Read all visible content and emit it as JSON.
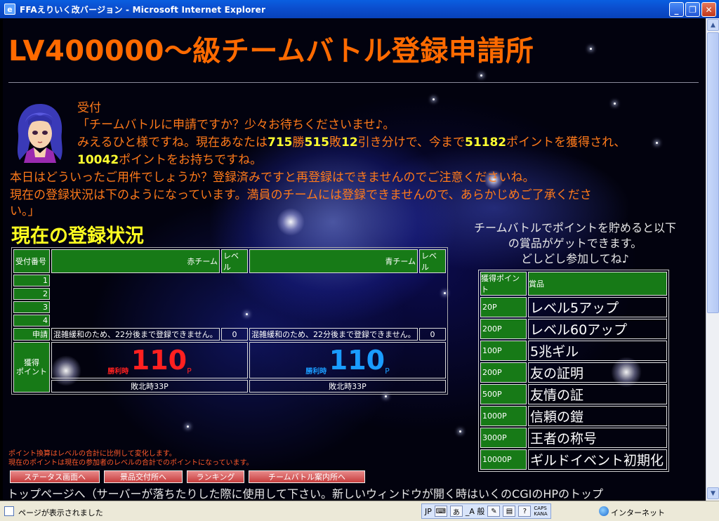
{
  "window": {
    "title": "FFAえりいく改バージョン - Microsoft Internet Explorer",
    "min_label": "_",
    "max_label": "❐",
    "close_label": "✕"
  },
  "page": {
    "title": "LV400000～級チームバトル登録申請所",
    "reception": {
      "speaker": "受付",
      "line1": "「チームバトルに申請ですか？少々お待ちくださいませ♪。",
      "line2_a": "みえるひと様ですね。現在あなたは",
      "wins": "715",
      "wins_unit": "勝",
      "losses": "515",
      "losses_unit": "敗",
      "draws": "12",
      "line2_b": "引き分けで、今まで",
      "points": "51182",
      "line2_c": "ポイントを獲得され、",
      "held_points": "10042",
      "line3": "ポイントをお持ちですね。",
      "line4": "本日はどういったご用件でしょうか？登録済みですと再登録はできませんのでご注意くださいね。",
      "line5": "現在の登録状況は下のようになっています。満員のチームには登録できませんので、あらかじめご了承くださ",
      "line6": "い。」"
    },
    "status_title": "現在の登録状況",
    "table": {
      "headers": {
        "number": "受付番号",
        "red_team": "赤チーム",
        "red_level": "レベル",
        "blue_team": "青チーム",
        "blue_level": "レベル"
      },
      "rows": [
        "1",
        "2",
        "3",
        "4"
      ],
      "apply_label": "申請",
      "red_note": "混雑緩和のため、22分後まで登録できません。",
      "red_level_value": "0",
      "blue_note": "混雑緩和のため、22分後まで登録できません。",
      "blue_level_value": "0",
      "points_label_1": "獲得",
      "points_label_2": "ポイント",
      "win_label": "勝利時",
      "red_win_points": "110",
      "blue_win_points": "110",
      "points_unit": "P",
      "red_lose": "敗北時33P",
      "blue_lose": "敗北時33P"
    },
    "prize_intro": [
      "チームバトルでポイントを貯めると以下",
      "の賞品がゲットできます。",
      "どしどし参加してね♪"
    ],
    "prize_table": {
      "header_points": "獲得ポイント",
      "header_item": "賞品",
      "rows": [
        {
          "points": "20P",
          "item": "レベル5アップ"
        },
        {
          "points": "200P",
          "item": "レベル60アップ"
        },
        {
          "points": "100P",
          "item": "5兆ギル"
        },
        {
          "points": "200P",
          "item": "友の証明"
        },
        {
          "points": "500P",
          "item": "友情の証"
        },
        {
          "points": "1000P",
          "item": "信頼の鎧"
        },
        {
          "points": "3000P",
          "item": "王者の称号"
        },
        {
          "points": "10000P",
          "item": "ギルドイベント初期化"
        }
      ]
    },
    "notes": [
      "ポイント換算はレベルの合計に比例して変化します。",
      "現在のポイントは現在の参加者のレベルの合計でのポイントになっています。"
    ],
    "buttons": {
      "status": "ステータス画面へ",
      "prize": "景品交付所へ",
      "ranking": "ランキング",
      "guide": "チームバトル案内所へ"
    },
    "bottom_text": "トップページへ（サーバーが落ちたりした際に使用して下さい。新しいウィンドウが開く時はいくのCGIのHPのトップ"
  },
  "statusbar": {
    "text": "ページが表示されました",
    "lang": "JP",
    "ime_mode": "_A 般",
    "caps": "CAPS",
    "kana": "KANA",
    "zone": "インターネット"
  }
}
